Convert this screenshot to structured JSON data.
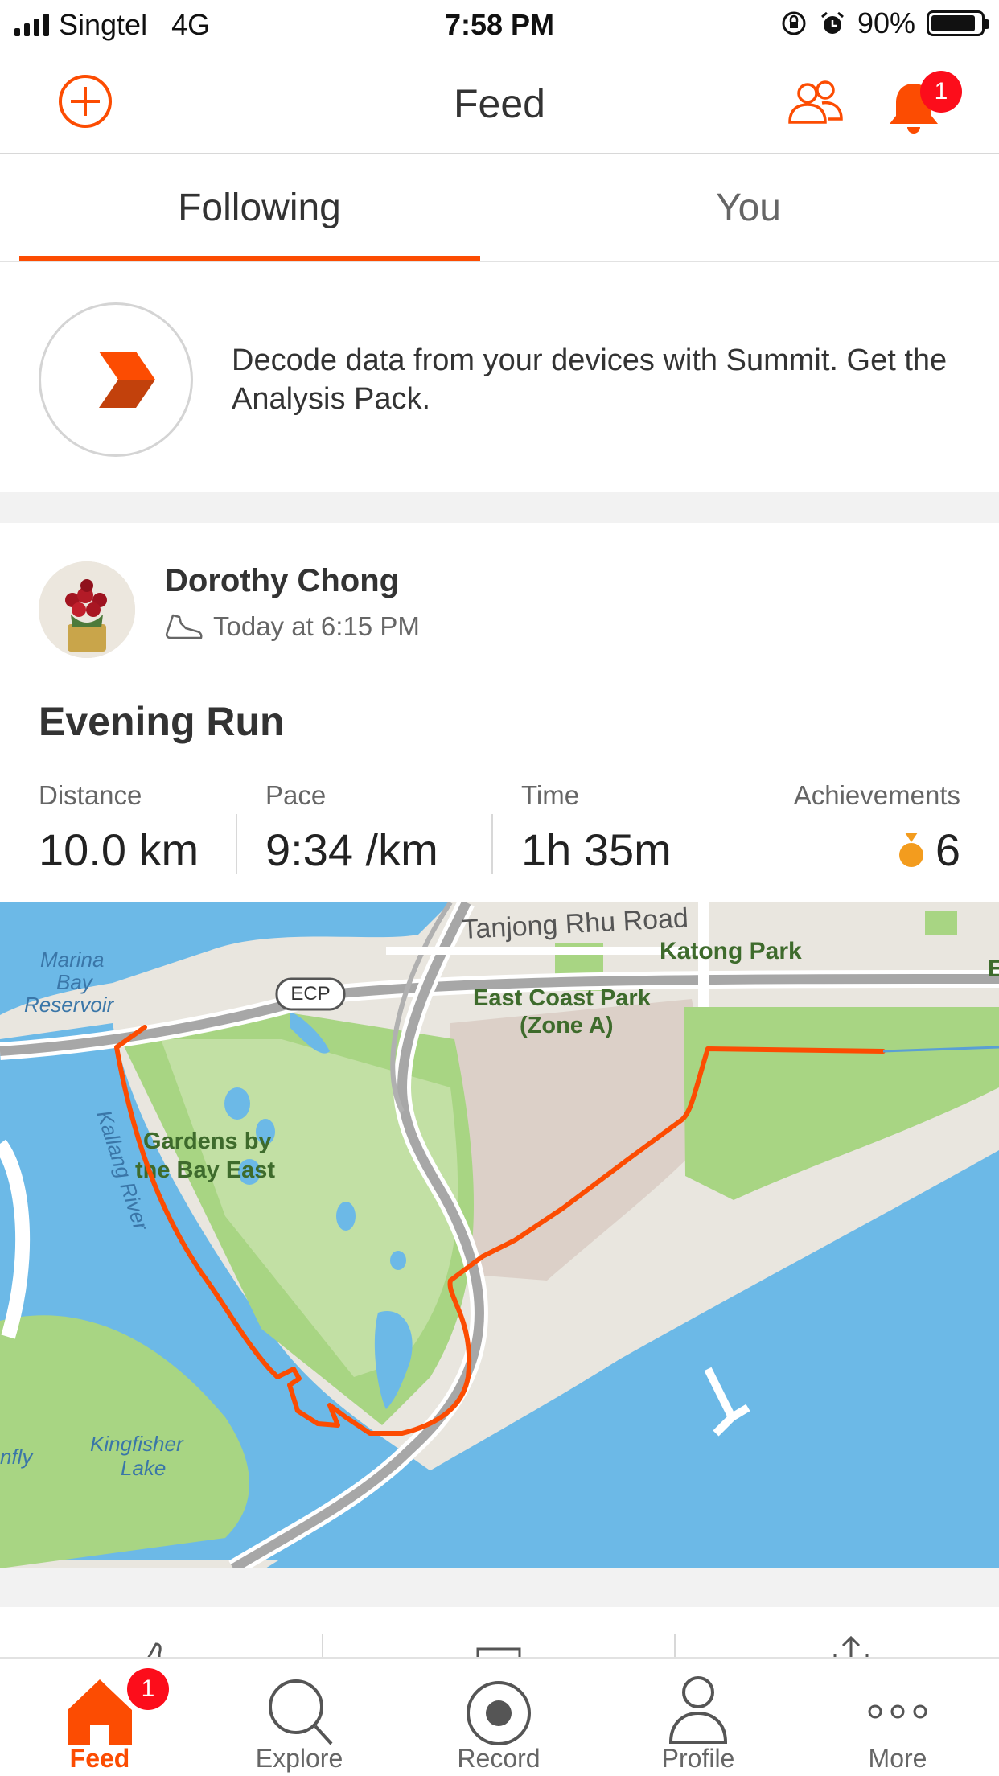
{
  "status_bar": {
    "carrier": "Singtel",
    "network": "4G",
    "time": "7:58 PM",
    "battery": "90%",
    "battery_level": 0.9
  },
  "header": {
    "title": "Feed",
    "notification_count": "1"
  },
  "tabs": [
    {
      "label": "Following",
      "active": true
    },
    {
      "label": "You",
      "active": false
    }
  ],
  "promo": {
    "text": "Decode data from your devices with Summit. Get the Analysis Pack."
  },
  "activity": {
    "athlete": "Dorothy Chong",
    "timestamp": "Today at 6:15 PM",
    "sport_icon": "shoe-icon",
    "title": "Evening Run",
    "stats": [
      {
        "label": "Distance",
        "value": "10.0 km"
      },
      {
        "label": "Pace",
        "value": "9:34 /km"
      },
      {
        "label": "Time",
        "value": "1h 35m"
      }
    ],
    "achievements": {
      "label": "Achievements",
      "value": "6",
      "icon": "medal-icon"
    },
    "map": {
      "labels": {
        "road_tanjong": "Tanjong Rhu Road",
        "katong": "Katong Park",
        "marina_1": "Marina",
        "marina_2": "Bay",
        "marina_3": "Reservoir",
        "ecp": "ECP",
        "ecpark_1": "East Coast Park",
        "ecpark_2": "(Zone A)",
        "gardens_1": "Gardens by",
        "gardens_2": "the Bay East",
        "kallang": "Kallang River",
        "kingfisher_1": "Kingfisher",
        "kingfisher_2": "Lake",
        "fly": "nfly",
        "e_edge": "E"
      },
      "route_color": "#fc4c02"
    }
  },
  "tab_bar": {
    "items": [
      {
        "label": "Feed",
        "icon": "home-icon",
        "active": true,
        "badge": "1"
      },
      {
        "label": "Explore",
        "icon": "search-icon",
        "active": false
      },
      {
        "label": "Record",
        "icon": "record-icon",
        "active": false
      },
      {
        "label": "Profile",
        "icon": "person-icon",
        "active": false
      },
      {
        "label": "More",
        "icon": "more-icon",
        "active": false
      }
    ]
  },
  "colors": {
    "accent": "#fc4c02",
    "badge": "#fc0d1b",
    "water": "#6cb9e7",
    "park": "#a8d583"
  }
}
